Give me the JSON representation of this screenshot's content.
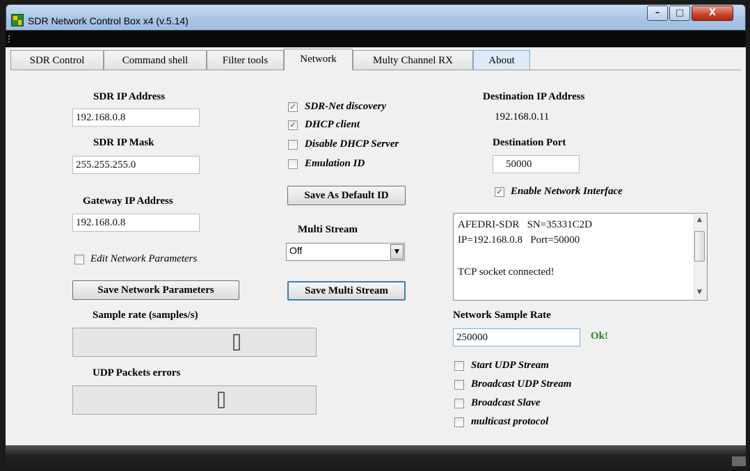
{
  "window": {
    "title": "SDR Network Control Box x4 (v.5.14)",
    "minimize": "–",
    "maximize": "□",
    "close": "X"
  },
  "tabs": [
    "SDR Control",
    "Command shell",
    "Filter tools",
    "Network",
    "Multy Channel RX",
    "About"
  ],
  "active_tab": "Network",
  "left": {
    "sdr_ip_label": "SDR IP Address",
    "sdr_ip_value": "192.168.0.8",
    "sdr_mask_label": "SDR IP Mask",
    "sdr_mask_value": "255.255.255.0",
    "gateway_label": "Gateway IP Address",
    "gateway_value": "192.168.0.8",
    "edit_params_label": "Edit Network Parameters",
    "save_params_button": "Save Network Parameters",
    "sample_rate_label": "Sample rate (samples/s)",
    "sample_rate_digit": "0",
    "udp_errors_label": "UDP Packets errors",
    "udp_errors_digit": "0"
  },
  "middle": {
    "sdr_net_discovery": "SDR-Net discovery",
    "dhcp_client": "DHCP client",
    "disable_dhcp_server": "Disable DHCP Server",
    "emulation_id": "Emulation ID",
    "save_default_id_button": "Save As Default ID",
    "multi_stream_label": "Multi Stream",
    "multi_stream_value": "Off",
    "save_multi_stream_button": "Save Multi Stream"
  },
  "right": {
    "dest_ip_label": "Destination IP Address",
    "dest_ip_value": "192.168.0.11",
    "dest_port_label": "Destination Port",
    "dest_port_value": "50000",
    "enable_network_interface": "Enable Network Interface",
    "log_lines": [
      "AFEDRI-SDR   SN=35331C2D",
      "IP=192.168.0.8   Port=50000",
      "",
      "TCP socket connected!"
    ],
    "network_sample_rate_label": "Network Sample Rate",
    "network_sample_rate_value": "250000",
    "status": "Ok!",
    "start_udp_stream": "Start UDP Stream",
    "broadcast_udp_stream": "Broadcast UDP Stream",
    "broadcast_slave": "Broadcast Slave",
    "multicast_protocol": "multicast protocol"
  },
  "checkboxes": {
    "sdr_net_discovery": true,
    "dhcp_client": true,
    "disable_dhcp_server": false,
    "emulation_id": false,
    "edit_network_parameters": false,
    "enable_network_interface": true,
    "start_udp_stream": false,
    "broadcast_udp_stream": false,
    "broadcast_slave": false,
    "multicast_protocol": false
  },
  "colors": {
    "ok_status": "#1f8a1f",
    "about_tab": "#ddeaf8",
    "client_bg": "#f0f0f0"
  }
}
